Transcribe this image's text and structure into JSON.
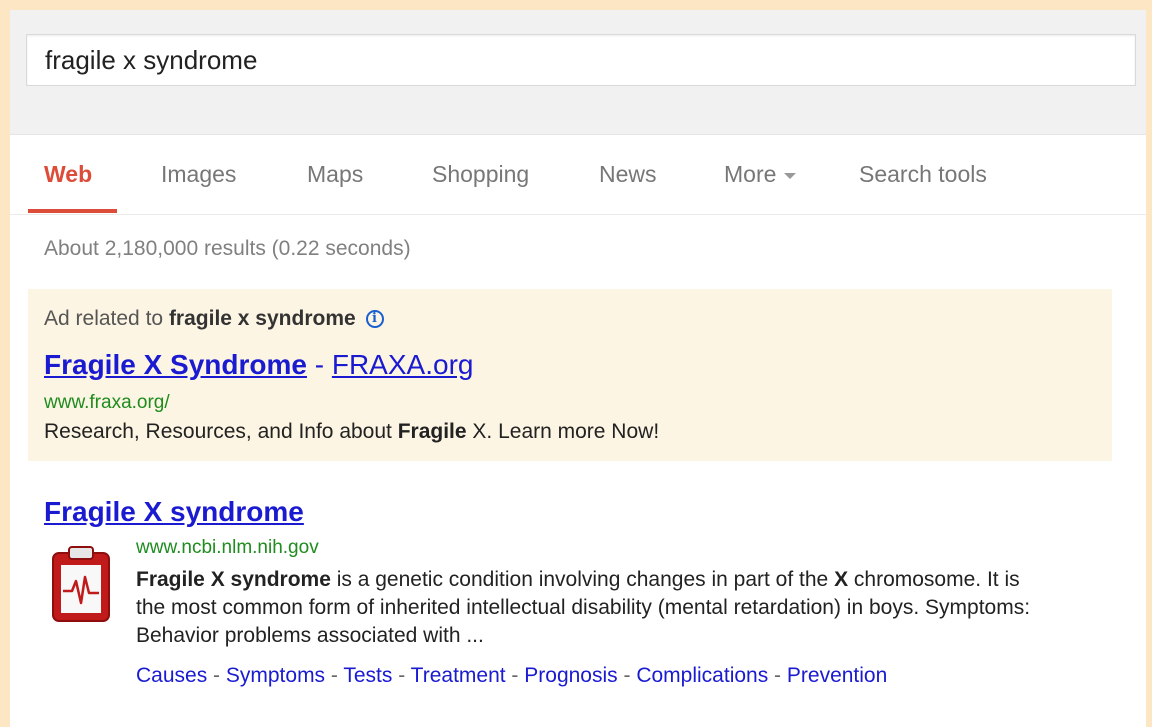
{
  "search": {
    "query": "fragile x syndrome"
  },
  "tabs": [
    {
      "label": "Web",
      "active": true
    },
    {
      "label": "Images"
    },
    {
      "label": "Maps"
    },
    {
      "label": "Shopping"
    },
    {
      "label": "News"
    },
    {
      "label": "More"
    },
    {
      "label": "Search tools"
    }
  ],
  "stats": "About 2,180,000 results (0.22 seconds)",
  "ad": {
    "label_prefix": "Ad related to",
    "label_query": "fragile x syndrome",
    "info_icon": "info-icon",
    "title_main": "Fragile X Syndrome",
    "title_sep": " - ",
    "title_site": "FRAXA.org",
    "url": "www.fraxa.org/",
    "desc_before": "Research, Resources, and Info about ",
    "desc_bold": "Fragile",
    "desc_after": " X. Learn more Now!"
  },
  "result": {
    "title": "Fragile X syndrome",
    "thumb_icon": "medical-clipboard-icon",
    "url": "www.ncbi.nlm.nih.gov",
    "snippet_bold1": "Fragile X syndrome",
    "snippet_text1": " is a genetic condition involving changes in part of the ",
    "snippet_bold2": "X",
    "snippet_text2": " chromosome. It is the most common form of inherited intellectual disability (mental retardation) in boys. Symptoms: Behavior problems associated with ...",
    "sitelinks": [
      "Causes",
      "Symptoms",
      "Tests",
      "Treatment",
      "Prognosis",
      "Complications",
      "Prevention"
    ],
    "sitelink_sep": " - "
  },
  "colors": {
    "accent_red": "#dd4b39",
    "link_blue": "#1a1ad1",
    "url_green": "#1e8c1e",
    "ad_bg": "#fdf5e3",
    "page_bg": "#fde6c4"
  }
}
